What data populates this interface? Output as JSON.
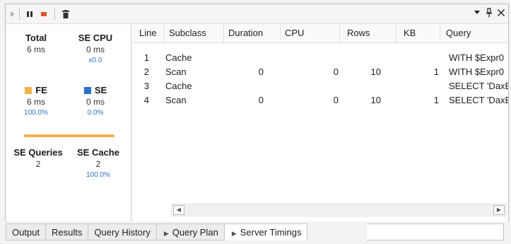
{
  "toolbar": {
    "icons": [
      "play-icon",
      "pause-icon",
      "stop-icon",
      "trash-icon"
    ],
    "window_controls": [
      "chevron-down-icon",
      "pin-icon",
      "close-icon"
    ]
  },
  "summary": {
    "total": {
      "label": "Total",
      "value": "6 ms"
    },
    "se_cpu": {
      "label": "SE CPU",
      "value": "0 ms",
      "sub": "x0.0"
    },
    "fe": {
      "label": "FE",
      "value": "6 ms",
      "pct": "100.0%",
      "color": "#f0b04a"
    },
    "se": {
      "label": "SE",
      "value": "0 ms",
      "pct": "0.0%",
      "color": "#2f6fc4"
    },
    "se_queries": {
      "label": "SE Queries",
      "value": "2"
    },
    "se_cache": {
      "label": "SE Cache",
      "value": "2",
      "pct": "100.0%"
    }
  },
  "grid": {
    "headers": {
      "line": "Line",
      "subclass": "Subclass",
      "duration": "Duration",
      "cpu": "CPU",
      "rows": "Rows",
      "kb": "KB",
      "query": "Query"
    },
    "rows": [
      {
        "line": "1",
        "subclass": "Cache",
        "duration": "",
        "cpu": "",
        "rows": "",
        "kb": "",
        "query": "WITH $Expr0"
      },
      {
        "line": "2",
        "subclass": "Scan",
        "duration": "0",
        "cpu": "0",
        "rows": "10",
        "kb": "1",
        "query": "WITH $Expr0"
      },
      {
        "line": "3",
        "subclass": "Cache",
        "duration": "",
        "cpu": "",
        "rows": "",
        "kb": "",
        "query": "SELECT 'DaxE"
      },
      {
        "line": "4",
        "subclass": "Scan",
        "duration": "0",
        "cpu": "0",
        "rows": "10",
        "kb": "1",
        "query": "SELECT 'DaxE"
      }
    ]
  },
  "tabs": [
    {
      "label": "Output"
    },
    {
      "label": "Results"
    },
    {
      "label": "Query History"
    },
    {
      "label": "Query Plan"
    },
    {
      "label": "Server Timings",
      "active": true
    }
  ]
}
